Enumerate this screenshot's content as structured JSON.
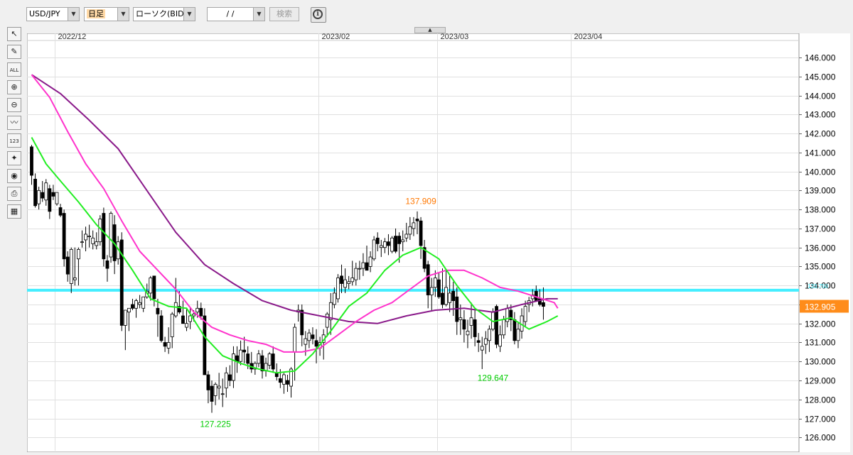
{
  "toolbar": {
    "symbol": "USD/JPY",
    "timeframe": "日足",
    "chart_kind": "ローソク(BID)",
    "date_value": "/ /",
    "search_label": "検索",
    "dropdown_glyph": "▼",
    "collapse_glyph": "▲",
    "info_glyph": "i"
  },
  "side_tools": [
    {
      "name": "pointer-icon",
      "glyph": "↖"
    },
    {
      "name": "pencil-icon",
      "glyph": "✎"
    },
    {
      "name": "erase-all-icon",
      "glyph": "ALL"
    },
    {
      "name": "zoom-in-icon",
      "glyph": "⊕"
    },
    {
      "name": "zoom-out-icon",
      "glyph": "⊖"
    },
    {
      "name": "indicator-icon",
      "glyph": "〰"
    },
    {
      "name": "numeric-icon",
      "glyph": "123"
    },
    {
      "name": "drawing-objects-icon",
      "glyph": "✦"
    },
    {
      "name": "eye-icon",
      "glyph": "◉"
    },
    {
      "name": "print-icon",
      "glyph": "⎙"
    },
    {
      "name": "table-icon",
      "glyph": "▦"
    }
  ],
  "colors": {
    "candle_up": "#ffffff",
    "candle_down": "#000000",
    "ma_short": "#22ee22",
    "ma_mid": "#ff33cc",
    "ma_long": "#8a1a8a",
    "hline": "#44eeff",
    "price_tag": "#ff8c1a",
    "high_label": "#ff7700",
    "low_label": "#00cc00"
  },
  "chart_data": {
    "type": "candlestick",
    "x_tick_labels": [
      "2022/12",
      "2023/02",
      "2023/03",
      "2023/04"
    ],
    "x_tick_index": [
      7,
      80,
      113,
      150
    ],
    "y_range": [
      125.3,
      146.9
    ],
    "y_ticks": [
      126,
      127,
      128,
      129,
      130,
      131,
      132,
      133,
      134,
      135,
      136,
      137,
      138,
      139,
      140,
      141,
      142,
      143,
      144,
      145,
      146
    ],
    "grid": true,
    "candles_ohlc": [
      [
        141.3,
        141.4,
        139.3,
        139.8
      ],
      [
        139.6,
        139.9,
        138.1,
        138.2
      ],
      [
        138.3,
        139.2,
        138.0,
        139.0
      ],
      [
        138.9,
        139.5,
        138.4,
        138.6
      ],
      [
        138.5,
        139.6,
        138.2,
        139.4
      ],
      [
        139.1,
        139.3,
        137.5,
        137.9
      ],
      [
        138.9,
        139.3,
        138.5,
        138.7
      ],
      [
        138.3,
        138.9,
        138.2,
        138.9
      ],
      [
        138.1,
        138.3,
        137.6,
        137.7
      ],
      [
        137.8,
        138.0,
        135.0,
        135.4
      ],
      [
        135.5,
        135.8,
        134.2,
        134.6
      ],
      [
        134.1,
        136.0,
        133.6,
        135.9
      ],
      [
        134.3,
        136.0,
        134.0,
        134.4
      ],
      [
        135.4,
        136.0,
        134.0,
        135.9
      ],
      [
        136.3,
        136.9,
        136.0,
        136.3
      ],
      [
        136.4,
        137.1,
        135.8,
        136.7
      ],
      [
        136.6,
        137.2,
        136.0,
        136.6
      ],
      [
        136.2,
        136.9,
        135.9,
        136.5
      ],
      [
        136.1,
        136.8,
        135.9,
        136.3
      ],
      [
        136.3,
        137.7,
        136.1,
        137.5
      ],
      [
        137.8,
        138.1,
        135.0,
        135.4
      ],
      [
        135.3,
        135.6,
        134.2,
        134.9
      ],
      [
        135.5,
        137.9,
        135.2,
        137.8
      ],
      [
        137.2,
        137.7,
        134.6,
        135.3
      ],
      [
        135.4,
        136.6,
        135.1,
        136.3
      ],
      [
        136.4,
        136.8,
        131.6,
        131.9
      ],
      [
        131.9,
        132.7,
        130.6,
        132.7
      ],
      [
        132.6,
        132.8,
        131.6,
        132.8
      ],
      [
        133.0,
        133.3,
        132.7,
        132.8
      ],
      [
        132.8,
        133.3,
        132.3,
        133.2
      ],
      [
        133.0,
        133.5,
        132.8,
        133.1
      ],
      [
        132.8,
        133.3,
        132.6,
        133.4
      ],
      [
        133.4,
        134.1,
        133.3,
        133.7
      ],
      [
        133.6,
        134.5,
        133.2,
        134.4
      ],
      [
        134.5,
        134.5,
        132.9,
        133.3
      ],
      [
        132.8,
        133.3,
        131.3,
        132.5
      ],
      [
        132.4,
        132.7,
        131.0,
        131.1
      ],
      [
        131.0,
        131.3,
        130.5,
        130.8
      ],
      [
        130.7,
        131.8,
        130.4,
        131.0
      ],
      [
        131.3,
        132.6,
        130.7,
        132.5
      ],
      [
        132.4,
        134.4,
        132.3,
        133.1
      ],
      [
        132.9,
        133.7,
        132.5,
        132.6
      ],
      [
        132.4,
        133.2,
        132.2,
        132.0
      ],
      [
        131.8,
        132.8,
        131.6,
        132.0
      ],
      [
        132.1,
        132.8,
        131.7,
        132.4
      ],
      [
        132.4,
        132.7,
        132.1,
        132.5
      ],
      [
        132.6,
        133.2,
        132.3,
        132.8
      ],
      [
        132.8,
        133.1,
        132.2,
        132.4
      ],
      [
        132.4,
        132.8,
        130.0,
        129.3
      ],
      [
        129.3,
        129.5,
        127.8,
        128.5
      ],
      [
        128.7,
        129.0,
        127.3,
        127.9
      ],
      [
        128.2,
        128.9,
        127.7,
        128.8
      ],
      [
        128.6,
        129.4,
        128.0,
        128.7
      ],
      [
        128.3,
        129.1,
        127.6,
        128.3
      ],
      [
        128.6,
        129.7,
        128.1,
        129.4
      ],
      [
        129.3,
        129.8,
        128.7,
        129.0
      ],
      [
        129.0,
        130.8,
        128.6,
        130.4
      ],
      [
        130.3,
        130.8,
        129.4,
        130.0
      ],
      [
        130.0,
        131.1,
        129.8,
        130.6
      ],
      [
        130.6,
        131.3,
        129.9,
        130.5
      ],
      [
        130.4,
        130.8,
        129.6,
        129.9
      ],
      [
        129.9,
        130.5,
        129.4,
        129.6
      ],
      [
        129.6,
        130.0,
        129.3,
        129.9
      ],
      [
        129.9,
        130.6,
        129.7,
        130.4
      ],
      [
        130.3,
        130.6,
        129.1,
        129.5
      ],
      [
        129.5,
        130.2,
        129.2,
        129.9
      ],
      [
        129.8,
        130.5,
        129.6,
        130.4
      ],
      [
        130.4,
        130.8,
        129.4,
        129.6
      ],
      [
        129.4,
        129.9,
        129.0,
        129.2
      ],
      [
        129.1,
        129.6,
        128.6,
        128.9
      ],
      [
        128.8,
        129.4,
        128.3,
        129.3
      ],
      [
        129.0,
        129.3,
        128.4,
        128.8
      ],
      [
        128.7,
        129.7,
        128.1,
        129.6
      ],
      [
        130.5,
        132.0,
        129.0,
        131.8
      ],
      [
        132.6,
        133.0,
        132.1,
        132.7
      ],
      [
        132.7,
        133.0,
        130.8,
        131.4
      ],
      [
        130.9,
        131.6,
        130.3,
        131.2
      ],
      [
        131.1,
        131.7,
        130.7,
        131.5
      ],
      [
        131.4,
        131.8,
        130.9,
        131.2
      ],
      [
        131.1,
        131.7,
        129.9,
        130.8
      ],
      [
        130.7,
        131.3,
        130.3,
        131.0
      ],
      [
        131.0,
        131.7,
        130.1,
        131.4
      ],
      [
        131.8,
        132.6,
        131.3,
        132.5
      ],
      [
        132.2,
        133.6,
        131.4,
        133.1
      ],
      [
        133.0,
        133.9,
        132.8,
        133.6
      ],
      [
        133.3,
        134.6,
        133.1,
        134.4
      ],
      [
        134.5,
        135.1,
        133.6,
        134.1
      ],
      [
        133.9,
        134.9,
        133.6,
        134.3
      ],
      [
        134.1,
        134.5,
        133.8,
        134.2
      ],
      [
        134.2,
        135.3,
        134.0,
        134.4
      ],
      [
        134.3,
        135.2,
        134.0,
        134.9
      ],
      [
        134.9,
        135.3,
        134.3,
        134.9
      ],
      [
        134.9,
        135.7,
        134.5,
        135.2
      ],
      [
        135.2,
        136.1,
        134.9,
        134.8
      ],
      [
        135.0,
        135.8,
        134.7,
        135.5
      ],
      [
        135.4,
        136.6,
        135.3,
        136.4
      ],
      [
        136.5,
        136.8,
        135.8,
        136.2
      ],
      [
        136.0,
        136.4,
        135.5,
        136.1
      ],
      [
        136.0,
        136.5,
        135.7,
        136.3
      ],
      [
        136.3,
        136.7,
        135.6,
        136.1
      ],
      [
        135.8,
        136.6,
        135.7,
        136.5
      ],
      [
        136.6,
        137.0,
        135.7,
        135.8
      ],
      [
        136.6,
        136.8,
        135.2,
        136.2
      ],
      [
        136.3,
        136.9,
        135.8,
        136.4
      ],
      [
        136.5,
        137.3,
        136.3,
        136.7
      ],
      [
        136.7,
        137.6,
        136.4,
        137.1
      ],
      [
        137.0,
        137.6,
        136.6,
        137.3
      ],
      [
        137.5,
        137.9,
        136.7,
        137.4
      ],
      [
        137.4,
        137.6,
        135.4,
        136.1
      ],
      [
        136.0,
        136.4,
        134.7,
        134.9
      ],
      [
        135.1,
        135.3,
        132.8,
        133.5
      ],
      [
        133.5,
        134.4,
        132.7,
        133.9
      ],
      [
        133.9,
        134.8,
        133.4,
        134.4
      ],
      [
        134.3,
        134.7,
        133.3,
        133.4
      ],
      [
        133.6,
        134.9,
        132.8,
        133.0
      ],
      [
        133.0,
        134.8,
        132.9,
        133.9
      ],
      [
        133.1,
        134.5,
        132.6,
        133.6
      ],
      [
        133.7,
        134.2,
        132.4,
        133.2
      ],
      [
        133.4,
        133.9,
        131.4,
        132.1
      ],
      [
        132.2,
        133.0,
        131.4,
        132.3
      ],
      [
        132.2,
        132.7,
        131.0,
        131.7
      ],
      [
        131.4,
        132.2,
        130.7,
        131.6
      ],
      [
        131.9,
        133.1,
        131.2,
        132.3
      ],
      [
        132.2,
        132.8,
        130.8,
        131.3
      ],
      [
        131.1,
        131.5,
        130.5,
        131.0
      ],
      [
        130.6,
        131.3,
        129.6,
        130.8
      ],
      [
        130.9,
        131.6,
        130.4,
        131.2
      ],
      [
        131.1,
        131.9,
        130.5,
        131.7
      ],
      [
        131.7,
        132.8,
        131.6,
        132.6
      ],
      [
        132.9,
        133.0,
        130.7,
        130.9
      ],
      [
        130.8,
        131.9,
        130.5,
        131.4
      ],
      [
        131.4,
        132.4,
        131.2,
        132.2
      ],
      [
        132.1,
        133.0,
        131.8,
        132.8
      ],
      [
        132.7,
        133.0,
        131.6,
        132.2
      ],
      [
        132.2,
        132.6,
        130.9,
        131.1
      ],
      [
        131.1,
        132.1,
        130.7,
        131.7
      ],
      [
        131.6,
        132.8,
        131.2,
        132.4
      ],
      [
        132.1,
        133.2,
        131.8,
        132.9
      ],
      [
        133.0,
        133.4,
        132.6,
        133.2
      ],
      [
        133.3,
        133.8,
        132.9,
        133.5
      ],
      [
        133.7,
        134.0,
        133.4,
        133.2
      ],
      [
        133.3,
        133.8,
        132.9,
        133.0
      ],
      [
        133.1,
        133.9,
        132.2,
        132.9
      ]
    ],
    "ma_short": [
      [
        0,
        141.8
      ],
      [
        4,
        140.4
      ],
      [
        8,
        139.5
      ],
      [
        13,
        138.4
      ],
      [
        18,
        137.2
      ],
      [
        23,
        136.2
      ],
      [
        28,
        134.8
      ],
      [
        33,
        133.3
      ],
      [
        38,
        132.9
      ],
      [
        43,
        132.8
      ],
      [
        48,
        131.3
      ],
      [
        53,
        130.3
      ],
      [
        58,
        129.9
      ],
      [
        63,
        129.6
      ],
      [
        68,
        129.4
      ],
      [
        73,
        129.5
      ],
      [
        78,
        130.4
      ],
      [
        83,
        131.6
      ],
      [
        88,
        132.9
      ],
      [
        93,
        133.6
      ],
      [
        98,
        134.8
      ],
      [
        103,
        135.6
      ],
      [
        108,
        136.0
      ],
      [
        113,
        135.4
      ],
      [
        118,
        134.0
      ],
      [
        123,
        132.8
      ],
      [
        128,
        132.1
      ],
      [
        133,
        132.3
      ],
      [
        138,
        131.7
      ],
      [
        143,
        132.1
      ],
      [
        146,
        132.4
      ]
    ],
    "ma_mid": [
      [
        0,
        145.1
      ],
      [
        5,
        143.9
      ],
      [
        10,
        142.1
      ],
      [
        15,
        140.4
      ],
      [
        20,
        139.1
      ],
      [
        25,
        137.4
      ],
      [
        30,
        135.8
      ],
      [
        35,
        134.8
      ],
      [
        40,
        133.8
      ],
      [
        45,
        132.6
      ],
      [
        50,
        131.8
      ],
      [
        55,
        131.4
      ],
      [
        60,
        131.1
      ],
      [
        65,
        130.9
      ],
      [
        70,
        130.5
      ],
      [
        75,
        130.5
      ],
      [
        80,
        130.7
      ],
      [
        85,
        131.4
      ],
      [
        90,
        132.1
      ],
      [
        95,
        132.7
      ],
      [
        100,
        133.1
      ],
      [
        105,
        133.8
      ],
      [
        110,
        134.5
      ],
      [
        115,
        134.8
      ],
      [
        120,
        134.8
      ],
      [
        125,
        134.4
      ],
      [
        130,
        133.9
      ],
      [
        135,
        133.7
      ],
      [
        140,
        133.4
      ],
      [
        145,
        133.1
      ],
      [
        146,
        132.8
      ]
    ],
    "ma_long": [
      [
        0,
        145.1
      ],
      [
        8,
        144.1
      ],
      [
        16,
        142.7
      ],
      [
        24,
        141.2
      ],
      [
        32,
        139.0
      ],
      [
        40,
        136.8
      ],
      [
        48,
        135.1
      ],
      [
        56,
        134.1
      ],
      [
        64,
        133.2
      ],
      [
        72,
        132.7
      ],
      [
        80,
        132.4
      ],
      [
        88,
        132.1
      ],
      [
        96,
        132.0
      ],
      [
        104,
        132.4
      ],
      [
        112,
        132.7
      ],
      [
        120,
        132.8
      ],
      [
        128,
        132.6
      ],
      [
        136,
        133.0
      ],
      [
        143,
        133.3
      ],
      [
        146,
        133.3
      ]
    ],
    "hline_value": 133.75,
    "hline_label": "133.750",
    "current_price_label": "132.905",
    "current_price_value": 132.905,
    "annotations": [
      {
        "text": "137.909",
        "value": 137.909,
        "index": 108,
        "kind": "high"
      },
      {
        "text": "127.225",
        "value": 127.225,
        "index": 51,
        "kind": "low"
      },
      {
        "text": "129.647",
        "value": 129.647,
        "index": 128,
        "kind": "low"
      }
    ]
  }
}
